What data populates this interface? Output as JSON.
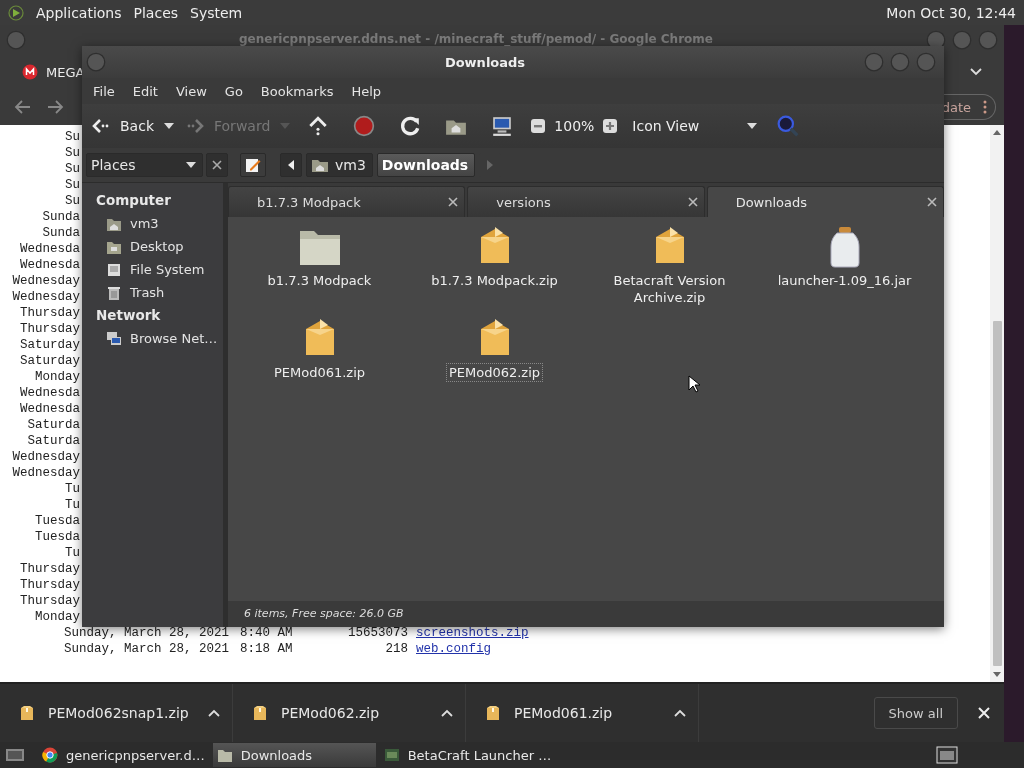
{
  "top_panel": {
    "menus": [
      "Applications",
      "Places",
      "System"
    ],
    "clock": "Mon Oct 30, 12:44"
  },
  "browser": {
    "title": "genericpnpserver.ddns.net - /minecraft_stuff/pemod/ - Google Chrome",
    "tab": "MEGA",
    "update_button": "date",
    "listing_fragments": [
      "Su",
      "Su",
      "Su",
      "Su",
      "Su",
      "Sunda",
      "Sunda",
      "Wednesda",
      "Wednesda",
      "Wednesday",
      "Wednesday",
      "Thursday",
      "Thursday",
      "Saturday",
      "Saturday",
      "Monday",
      "Wednesda",
      "Wednesda",
      "Saturda",
      "Saturda",
      "Wednesday",
      "Wednesday",
      "Tu",
      "Tu",
      "Tuesda",
      "Tuesda",
      "Tu",
      "Thursday",
      "Thursday",
      "Thursday",
      "Monday"
    ],
    "listing_rows": [
      {
        "date": "Sunday, March 28, 2021",
        "time": "8:40 AM",
        "size": "15653073",
        "file": "screenshots.zip"
      },
      {
        "date": "Sunday, March 28, 2021",
        "time": "8:18 AM",
        "size": "218",
        "file": "web.config"
      }
    ],
    "downloads": [
      {
        "name": "PEMod062snap1.zip"
      },
      {
        "name": "PEMod062.zip"
      },
      {
        "name": "PEMod061.zip"
      }
    ],
    "show_all": "Show all"
  },
  "file_manager": {
    "title": "Downloads",
    "menu": [
      "File",
      "Edit",
      "View",
      "Go",
      "Bookmarks",
      "Help"
    ],
    "nav_buttons": [
      {
        "kind": "back",
        "label": "Back",
        "disabled": false
      },
      {
        "kind": "forward",
        "label": "Forward",
        "disabled": true
      }
    ],
    "zoom": "100%",
    "view_mode": "Icon View",
    "side_pane_selector": "Places",
    "breadcrumbs": [
      {
        "label": "vm3",
        "kind": "home",
        "selected": false
      },
      {
        "label": "Downloads",
        "kind": "plain",
        "selected": true
      }
    ],
    "sidebar": [
      {
        "title": "Computer",
        "items": [
          {
            "label": "vm3",
            "kind": "home"
          },
          {
            "label": "Desktop",
            "kind": "desktop"
          },
          {
            "label": "File System",
            "kind": "drive"
          },
          {
            "label": "Trash",
            "kind": "trash"
          }
        ]
      },
      {
        "title": "Network",
        "items": [
          {
            "label": "Browse Net…",
            "kind": "network"
          }
        ]
      }
    ],
    "tabs": [
      {
        "label": "b1.7.3 Modpack",
        "selected": false
      },
      {
        "label": "versions",
        "selected": false
      },
      {
        "label": "Downloads",
        "selected": true
      }
    ],
    "files": [
      {
        "name": "b1.7.3 Modpack",
        "kind": "folder",
        "selected": false
      },
      {
        "name": "b1.7.3 Modpack.zip",
        "kind": "archive",
        "selected": false
      },
      {
        "name": "Betacraft Version Archive.zip",
        "kind": "archive",
        "selected": false
      },
      {
        "name": "launcher-1.09_16.jar",
        "kind": "jar",
        "selected": false
      },
      {
        "name": "PEMod061.zip",
        "kind": "archive",
        "selected": false
      },
      {
        "name": "PEMod062.zip",
        "kind": "archive",
        "selected": true
      }
    ],
    "status": "6 items, Free space: 26.0 GB"
  },
  "taskbar": [
    {
      "label": "genericpnpserver.d…",
      "kind": "browser",
      "selected": false
    },
    {
      "label": "Downloads",
      "kind": "folder",
      "selected": true
    },
    {
      "label": "BetaCraft Launcher …",
      "kind": "app",
      "selected": false
    }
  ]
}
